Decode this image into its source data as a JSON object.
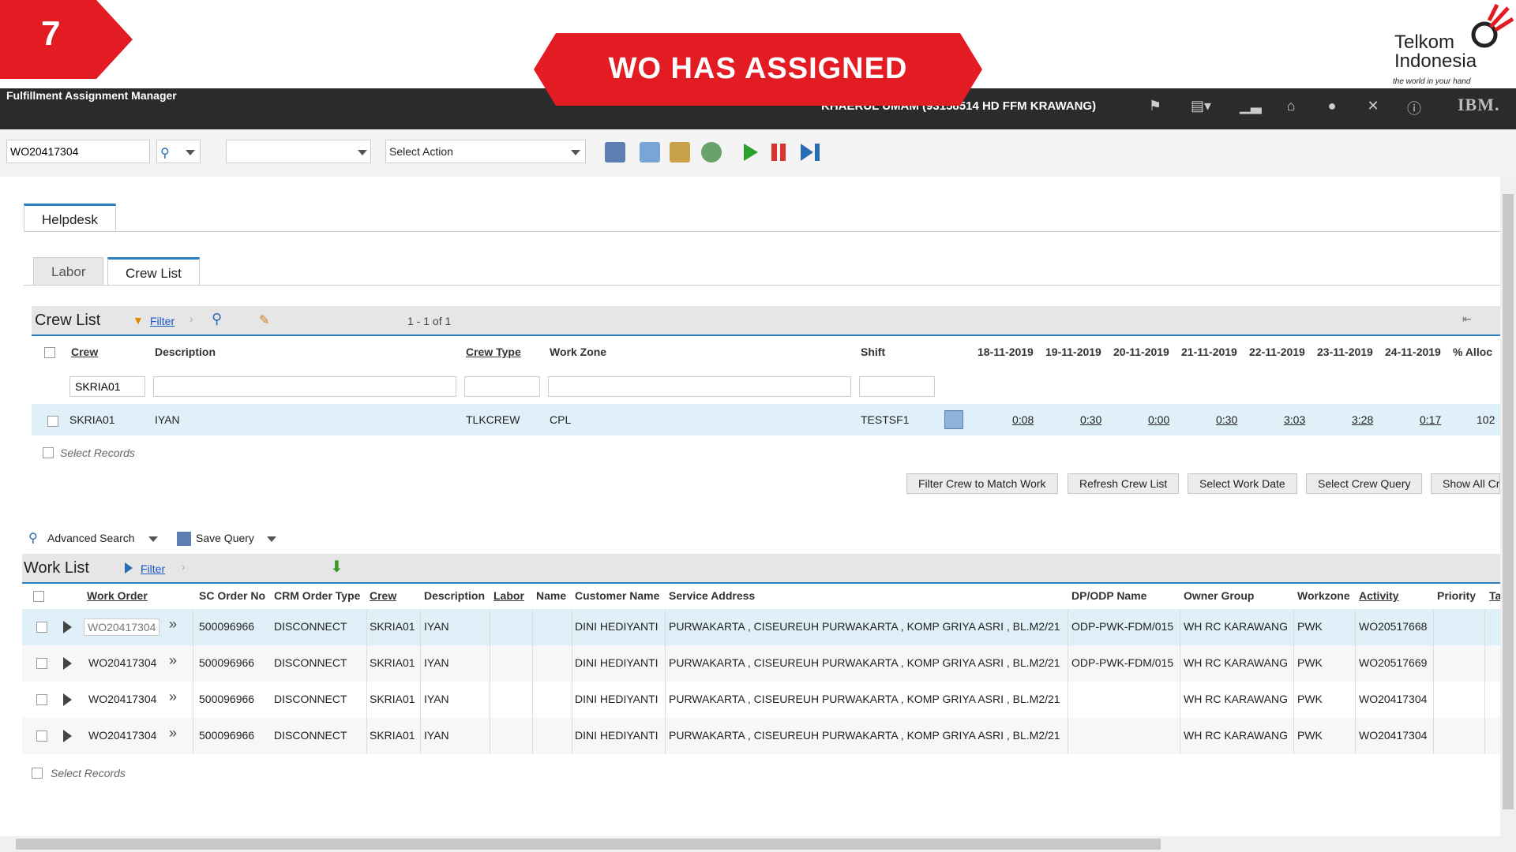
{
  "step_number": "7",
  "banner_text": "WO HAS ASSIGNED",
  "logo": {
    "line1": "Telkom",
    "line2": "Indonesia",
    "tagline": "the world in your hand"
  },
  "header": {
    "app_title": "Fulfillment Assignment Manager",
    "user": "KHAERUL UMAM (93158514 HD FFM KRAWANG)",
    "brand": "IBM."
  },
  "toolbar": {
    "search_value": "WO20417304",
    "blank_select": "",
    "action_select": "Select Action"
  },
  "tabs": {
    "main": "Helpdesk",
    "sub": [
      "Labor",
      "Crew List"
    ]
  },
  "crew_list": {
    "title": "Crew List",
    "filter": "Filter",
    "pagination": "1 - 1 of 1",
    "columns": [
      "Crew",
      "Description",
      "Crew Type",
      "Work Zone",
      "Shift",
      "18-11-2019",
      "19-11-2019",
      "20-11-2019",
      "21-11-2019",
      "22-11-2019",
      "23-11-2019",
      "24-11-2019",
      "% Alloc"
    ],
    "filter_crew": "SKRIA01",
    "row": {
      "crew": "SKRIA01",
      "description": "IYAN",
      "crew_type": "TLKCREW",
      "work_zone": "CPL",
      "shift": "TESTSF1",
      "days": [
        "0:08",
        "0:30",
        "0:00",
        "0:30",
        "3:03",
        "3:28",
        "0:17"
      ],
      "alloc": "102"
    },
    "select_records": "Select Records",
    "buttons": [
      "Filter Crew to Match Work",
      "Refresh Crew List",
      "Select Work Date",
      "Select Crew Query",
      "Show All Cr"
    ]
  },
  "query": {
    "advanced_search": "Advanced Search",
    "save_query": "Save Query"
  },
  "work_list": {
    "title": "Work List",
    "filter": "Filter",
    "columns": [
      "Work Order",
      "SC Order No",
      "CRM Order Type",
      "Crew",
      "Description",
      "Labor",
      "Name",
      "Customer Name",
      "Service Address",
      "DP/ODP Name",
      "Owner Group",
      "Workzone",
      "Activity",
      "Priority",
      "Ta"
    ],
    "rows": [
      {
        "wo": "WO20417304",
        "sc": "500096966",
        "crm": "DISCONNECT",
        "crew": "SKRIA01",
        "desc": "IYAN",
        "customer": "DINI HEDIYANTI",
        "address": "PURWAKARTA , CISEUREUH PURWAKARTA , KOMP GRIYA ASRI , BL.M2/21",
        "odp": "ODP-PWK-FDM/015",
        "owner": "WH RC KARAWANG",
        "workzone": "PWK",
        "activity": "WO20517668"
      },
      {
        "wo": "WO20417304",
        "sc": "500096966",
        "crm": "DISCONNECT",
        "crew": "SKRIA01",
        "desc": "IYAN",
        "customer": "DINI HEDIYANTI",
        "address": "PURWAKARTA , CISEUREUH PURWAKARTA , KOMP GRIYA ASRI , BL.M2/21",
        "odp": "ODP-PWK-FDM/015",
        "owner": "WH RC KARAWANG",
        "workzone": "PWK",
        "activity": "WO20517669"
      },
      {
        "wo": "WO20417304",
        "sc": "500096966",
        "crm": "DISCONNECT",
        "crew": "SKRIA01",
        "desc": "IYAN",
        "customer": "DINI HEDIYANTI",
        "address": "PURWAKARTA , CISEUREUH PURWAKARTA , KOMP GRIYA ASRI , BL.M2/21",
        "odp": "",
        "owner": "WH RC KARAWANG",
        "workzone": "PWK",
        "activity": "WO20417304"
      },
      {
        "wo": "WO20417304",
        "sc": "500096966",
        "crm": "DISCONNECT",
        "crew": "SKRIA01",
        "desc": "IYAN",
        "customer": "DINI HEDIYANTI",
        "address": "PURWAKARTA , CISEUREUH PURWAKARTA , KOMP GRIYA ASRI , BL.M2/21",
        "odp": "",
        "owner": "WH RC KARAWANG",
        "workzone": "PWK",
        "activity": "WO20417304"
      }
    ],
    "select_records": "Select Records"
  },
  "colors": {
    "brand_red": "#e31b23",
    "header_dark": "#2b2b2b",
    "selected_row": "#dff0f8",
    "link_blue": "#1a56c4"
  }
}
